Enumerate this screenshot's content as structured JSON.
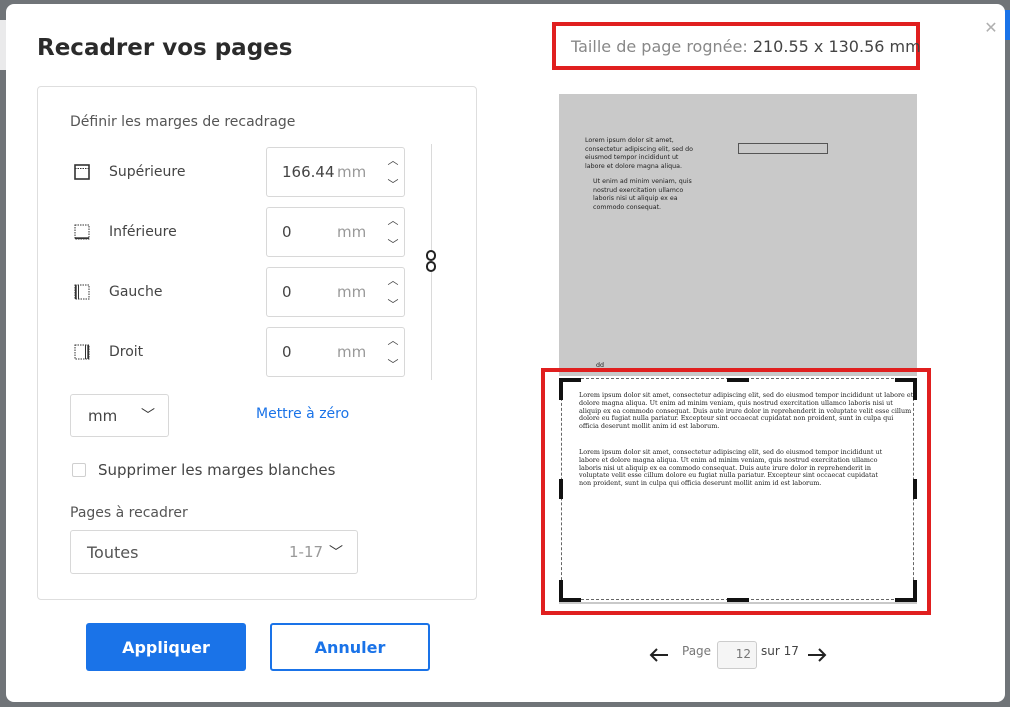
{
  "title": "Recadrer vos pages",
  "margins": {
    "section_label": "Définir les marges de recadrage",
    "rows": [
      {
        "label": "Supérieure",
        "value": "166.44",
        "unit": "mm",
        "icon": "margin-top-icon"
      },
      {
        "label": "Inférieure",
        "value": "0",
        "unit": "mm",
        "icon": "margin-bottom-icon"
      },
      {
        "label": "Gauche",
        "value": "0",
        "unit": "mm",
        "icon": "margin-left-icon"
      },
      {
        "label": "Droit",
        "value": "0",
        "unit": "mm",
        "icon": "margin-right-icon"
      }
    ],
    "unit_select": "mm",
    "reset_label": "Mettre à zéro"
  },
  "remove_white_margins": {
    "label": "Supprimer les marges blanches",
    "checked": false
  },
  "pages": {
    "label": "Pages à recadrer",
    "value": "Toutes",
    "range": "1-17"
  },
  "buttons": {
    "apply": "Appliquer",
    "cancel": "Annuler"
  },
  "preview": {
    "size_label": "Taille de page rognée:",
    "size_value": "210.55 x 130.56 mm",
    "top_text_1": "Lorem ipsum dolor sit amet, consectetur adipiscing elit, sed do eiusmod tempor incididunt ut labore et dolore magna aliqua.",
    "top_text_2": "Ut enim ad minim veniam, quis nostrud exercitation ullamco laboris nisi ut aliquip ex ea commodo consequat.",
    "top_footer": "dd",
    "crop_text_1": "Lorem ipsum dolor sit amet, consectetur adipiscing elit, sed do eiusmod tempor incididunt ut labore et dolore magna aliqua. Ut enim ad minim veniam, quis nostrud exercitation ullamco laboris nisi ut aliquip ex ea commodo consequat. Duis aute irure dolor in reprehenderit in voluptate velit esse cillum dolore eu fugiat nulla pariatur. Excepteur sint occaecat cupidatat non proident, sunt in culpa qui officia deserunt mollit anim id est laborum.",
    "crop_text_2": "Lorem ipsum dolor sit amet, consectetur adipiscing elit, sed do eiusmod tempor incididunt ut labore et dolore magna aliqua. Ut enim ad minim veniam, quis nostrud exercitation ullamco laboris nisi ut aliquip ex ea commodo consequat. Duis aute irure dolor in reprehenderit in voluptate velit esse cillum dolore eu fugiat nulla pariatur. Excepteur sint occaecat cupidatat non proident, sunt in culpa qui officia deserunt mollit anim id est laborum."
  },
  "pager": {
    "page_label": "Page",
    "current": "12",
    "of_label": "sur 17"
  },
  "colors": {
    "accent": "#1a73e8",
    "highlight": "#e01f1f"
  }
}
